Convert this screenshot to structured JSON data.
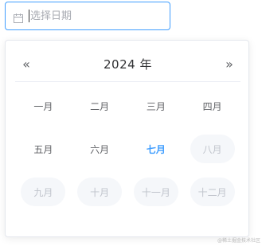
{
  "date_input": {
    "placeholder": "选择日期",
    "icon": "calendar-icon"
  },
  "panel": {
    "prev_year_label": "«",
    "next_year_label": "»",
    "year_title": "2024 年",
    "months": [
      {
        "label": "一月",
        "state": "enabled"
      },
      {
        "label": "二月",
        "state": "enabled"
      },
      {
        "label": "三月",
        "state": "enabled"
      },
      {
        "label": "四月",
        "state": "enabled"
      },
      {
        "label": "五月",
        "state": "enabled"
      },
      {
        "label": "六月",
        "state": "enabled"
      },
      {
        "label": "七月",
        "state": "current"
      },
      {
        "label": "八月",
        "state": "disabled"
      },
      {
        "label": "九月",
        "state": "disabled"
      },
      {
        "label": "十月",
        "state": "disabled"
      },
      {
        "label": "十一月",
        "state": "disabled"
      },
      {
        "label": "十二月",
        "state": "disabled"
      }
    ]
  },
  "colors": {
    "accent": "#409eff",
    "text": "#606266",
    "disabled_text": "#c0c4cc",
    "disabled_bg": "#f5f7fa"
  },
  "watermark": "@稀土掘金技术社区"
}
